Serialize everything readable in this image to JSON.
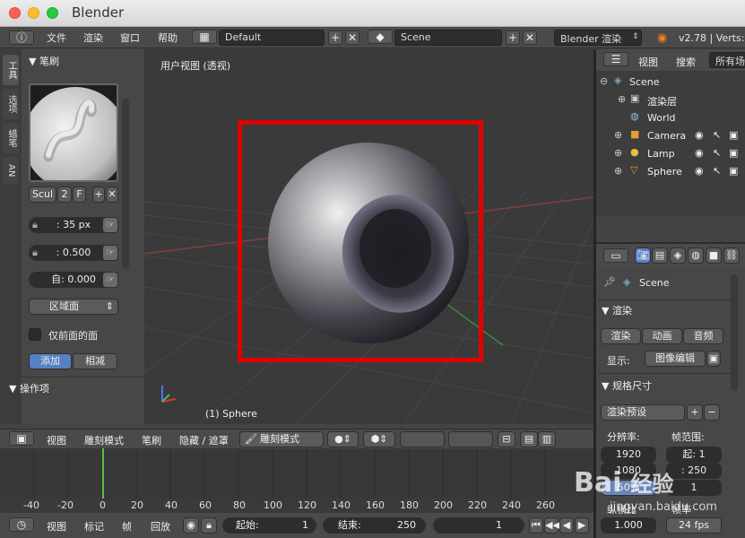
{
  "window": {
    "title": "Blender"
  },
  "header": {
    "menus": [
      "文件",
      "渲染",
      "窗口",
      "帮助"
    ],
    "screen_layout": "Default",
    "scene": "Scene",
    "render_engine": "Blender 渲染",
    "version": "v2.78 | Verts:"
  },
  "left_tabs": [
    "工具",
    "选项",
    "蜡笔",
    "AN"
  ],
  "brush_panel": {
    "title": "笔刷",
    "brush_name": "Scul",
    "users": "2",
    "fake": "F",
    "radius": ": 35 px",
    "strength": ": 0.500",
    "autosmooth": "自:  0.000",
    "area": "区域面",
    "front_faces": "仅前面的面",
    "add_label": "添加",
    "subtract_label": "相减",
    "operator_title": "操作项"
  },
  "viewport": {
    "label": "用户视图 (透视)",
    "object_label": "(1) Sphere"
  },
  "viewport_header": {
    "items": [
      "视图",
      "雕刻模式",
      "笔刷",
      "隐藏 / 遮罩"
    ],
    "mode": "雕刻模式"
  },
  "outliner": {
    "header_items": [
      "视图",
      "搜索",
      "所有场"
    ],
    "rows": [
      {
        "label": "Scene"
      },
      {
        "label": "渲染层"
      },
      {
        "label": "World"
      },
      {
        "label": "Camera"
      },
      {
        "label": "Lamp"
      },
      {
        "label": "Sphere"
      }
    ]
  },
  "properties": {
    "scene": "Scene",
    "render_section": "渲染",
    "render_btn": "渲染",
    "anim_btn": "动画",
    "audio_btn": "音频",
    "display_label": "显示:",
    "display_value": "图像编辑",
    "dimensions_section": "规格尺寸",
    "preset": "渲染预设",
    "resolution_label": "分辨率:",
    "frame_range_label": "帧范围:",
    "res_x": "1920",
    "res_y": "1080",
    "res_pct": "50%",
    "frame_start": "起: 1",
    "frame_end": ": 250",
    "frame_step": "1",
    "aspect_label": "纵横比",
    "aspect": "1.000",
    "fps_label": "帧率",
    "fps": "24 fps"
  },
  "timeline": {
    "ruler": [
      "-40",
      "-20",
      "0",
      "20",
      "40",
      "60",
      "80",
      "100",
      "120",
      "140",
      "160",
      "180",
      "200",
      "220",
      "240",
      "260"
    ],
    "bar_items": [
      "视图",
      "标记",
      "帧",
      "回放"
    ],
    "start": "起始:",
    "start_val": "1",
    "end": "结束:",
    "end_val": "250",
    "current": "1"
  },
  "watermark": {
    "line1": "Bai",
    "line2": "经验",
    "url": "jingyan.baidu.com"
  },
  "colors": {
    "highlight_box": "#e00000",
    "active_button": "#5680c2",
    "keyframe": "#5ac03c"
  }
}
